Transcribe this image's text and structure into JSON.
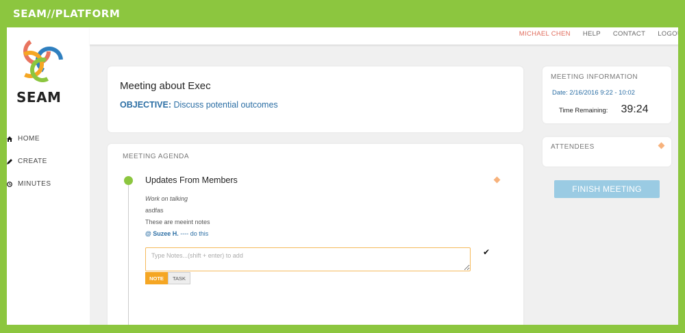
{
  "brand": {
    "title": "SEAM//PLATFORM"
  },
  "sidebar": {
    "logo_text": "SEAM",
    "items": [
      {
        "label": "HOME",
        "icon": "home-icon"
      },
      {
        "label": "CREATE",
        "icon": "pencil-icon"
      },
      {
        "label": "MINUTES",
        "icon": "clock-icon"
      }
    ]
  },
  "topbar": {
    "user": "MICHAEL CHEN",
    "help": "HELP",
    "contact": "CONTACT",
    "logout": "LOGOU"
  },
  "meeting": {
    "title": "Meeting about Exec",
    "objective_label": "OBJECTIVE:",
    "objective_text": " Discuss potential outcomes"
  },
  "agenda": {
    "heading": "MEETING AGENDA",
    "item_title": "Updates From Members",
    "notes": {
      "line1": "Work on talking",
      "line2": "asdfas",
      "line3": "These are meeint notes",
      "mention": "@ Suzee H.",
      "mention_rest": " ---- do this"
    },
    "input_placeholder": "Type Notes...(shift + enter) to add",
    "note_button": "NOTE",
    "task_button": "TASK"
  },
  "info": {
    "heading": "MEETING INFORMATION",
    "date": "Date: 2/16/2016 9:22 - 10:02",
    "time_label": "Time Remaining:",
    "time_value": "39:24"
  },
  "attendees": {
    "heading": "ATTENDEES"
  },
  "finish_button": "FINISH MEETING",
  "colors": {
    "brand_green": "#8cc63f",
    "link_blue": "#2b6ea4",
    "accent_orange": "#f5a623",
    "user_red": "#e06b5b",
    "finish_blue": "#9acbe3"
  }
}
